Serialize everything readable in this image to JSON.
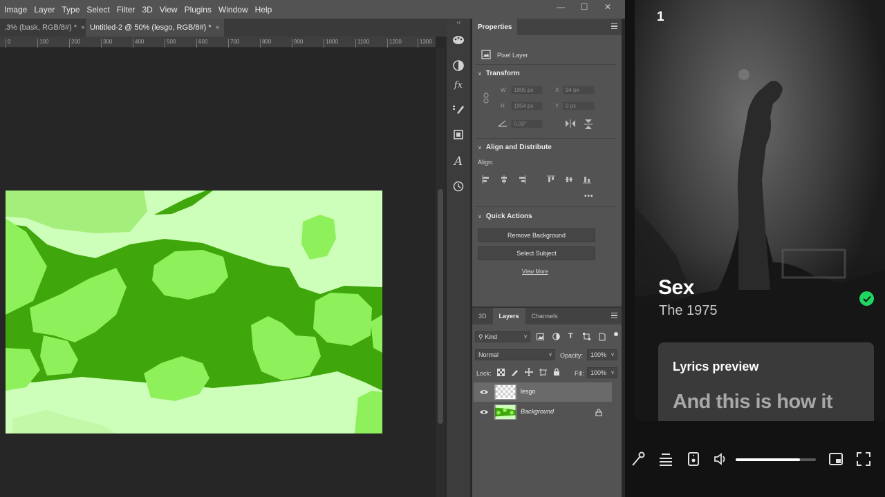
{
  "photoshop": {
    "menu": [
      "Image",
      "Layer",
      "Type",
      "Select",
      "Filter",
      "3D",
      "View",
      "Plugins",
      "Window",
      "Help"
    ],
    "window_controls": {
      "minimize": "—",
      "maximize": "☐",
      "close": "✕"
    },
    "tabs": [
      {
        "label": ".3% (bask, RGB/8#) *",
        "close": "×"
      },
      {
        "label": "Untitled-2 @ 50% (lesgo, RGB/8#) *",
        "close": "×"
      }
    ],
    "ruler_ticks": [
      "0",
      "100",
      "200",
      "300",
      "400",
      "500",
      "600",
      "700",
      "800",
      "900",
      "1000",
      "1100",
      "1200",
      "1300"
    ],
    "properties": {
      "tab": "Properties",
      "layer_type": "Pixel Layer",
      "transform": {
        "title": "Transform",
        "w_label": "W",
        "w_value": "1905 px",
        "x_label": "X",
        "x_value": "94 px",
        "h_label": "H",
        "h_value": "1954 px",
        "y_label": "Y",
        "y_value": "0 px",
        "angle_value": "0.00°"
      },
      "align": {
        "title": "Align and Distribute",
        "label": "Align:",
        "more": "•••"
      },
      "quick_actions": {
        "title": "Quick Actions",
        "remove_bg": "Remove Background",
        "select_subject": "Select Subject",
        "view_more": "View More"
      }
    },
    "layers_panel": {
      "tabs": [
        "3D",
        "Layers",
        "Channels"
      ],
      "active_tab": "Layers",
      "filter_kind": "Kind",
      "blend_mode": "Normal",
      "opacity_label": "Opacity:",
      "opacity_value": "100%",
      "lock_label": "Lock:",
      "fill_label": "Fill:",
      "fill_value": "100%",
      "layers": [
        {
          "name": "lesgo",
          "selected": true
        },
        {
          "name": "Background",
          "selected": false,
          "locked": true
        }
      ]
    }
  },
  "spotify": {
    "queue_number": "1",
    "song_title": "Sex",
    "artist": "The 1975",
    "lyrics_title": "Lyrics preview",
    "lyrics_line": "And this is how it",
    "volume_level": 0.8,
    "accent_color": "#1ed760"
  }
}
